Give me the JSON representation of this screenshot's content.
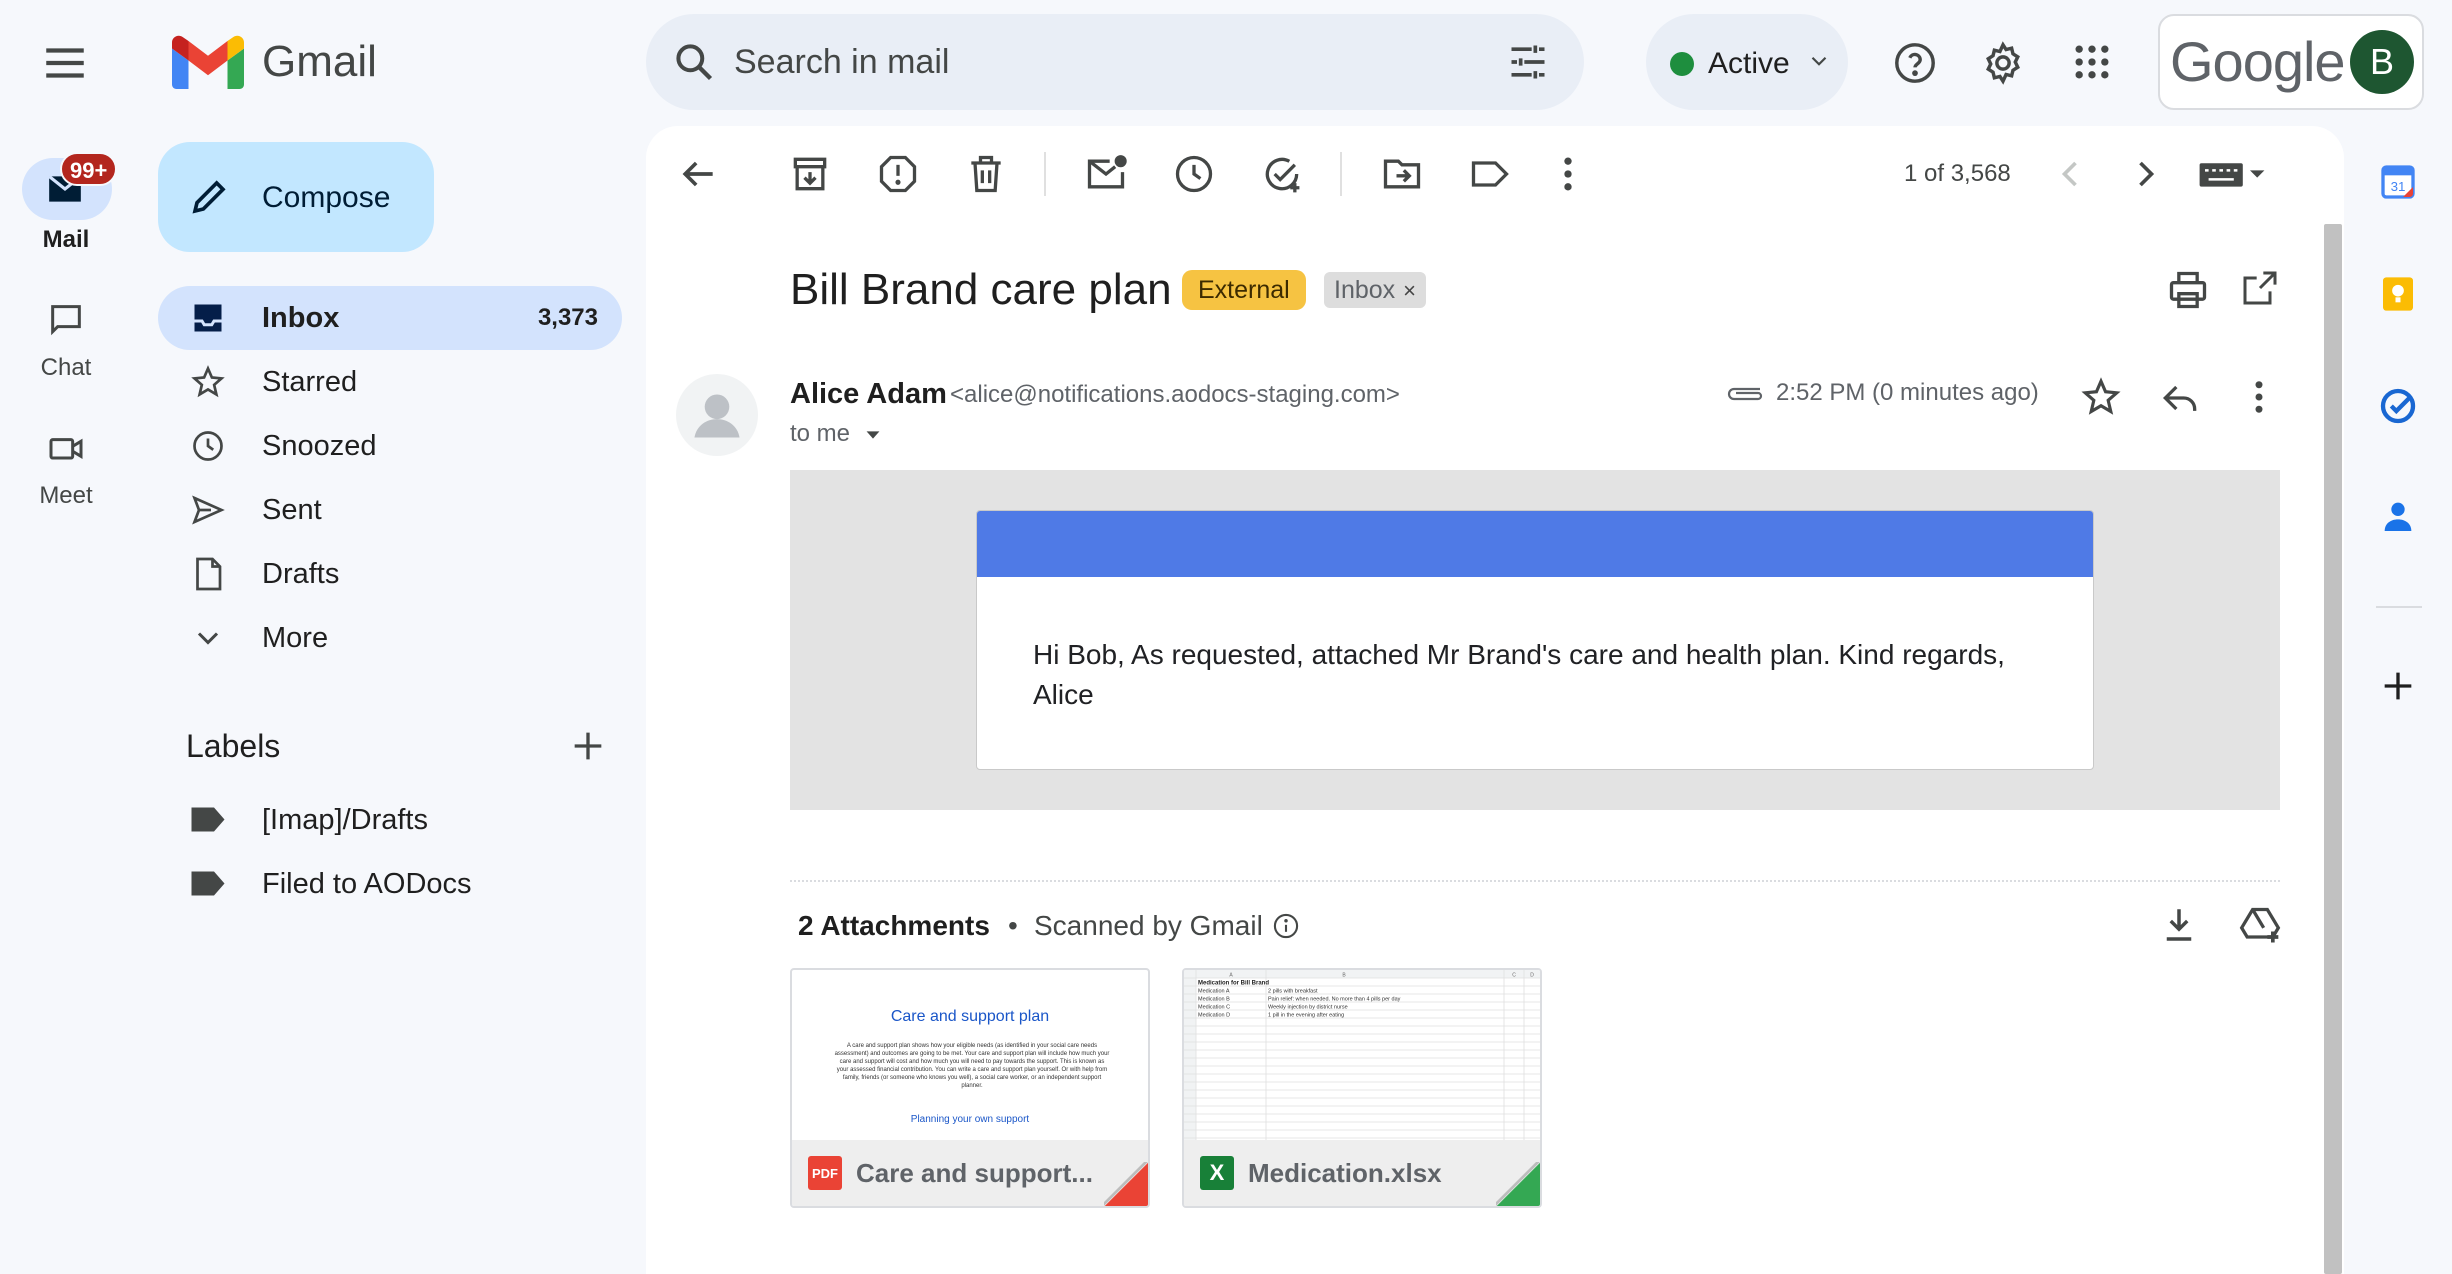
{
  "app": {
    "brand": "Gmail",
    "google_word": "Google",
    "avatar_letter": "B"
  },
  "search": {
    "placeholder": "Search in mail"
  },
  "status": {
    "label": "Active"
  },
  "rail": {
    "mail_label": "Mail",
    "mail_badge": "99+",
    "chat_label": "Chat",
    "meet_label": "Meet"
  },
  "nav": {
    "compose_label": "Compose",
    "items": [
      {
        "label": "Inbox",
        "count": "3,373"
      },
      {
        "label": "Starred",
        "count": ""
      },
      {
        "label": "Snoozed",
        "count": ""
      },
      {
        "label": "Sent",
        "count": ""
      },
      {
        "label": "Drafts",
        "count": ""
      },
      {
        "label": "More",
        "count": ""
      }
    ],
    "labels_title": "Labels",
    "labels": [
      {
        "label": "[Imap]/Drafts"
      },
      {
        "label": "Filed to AODocs"
      }
    ]
  },
  "toolbar": {
    "pager": "1 of 3,568"
  },
  "message": {
    "subject": "Bill Brand care plan",
    "tag_external": "External",
    "tag_inbox": "Inbox",
    "tag_remove": "×",
    "sender_name": "Alice Adam",
    "sender_email": "<alice@notifications.aodocs-staging.com>",
    "to": "to me",
    "time": "2:52 PM (0 minutes ago)",
    "body": "Hi Bob, As requested, attached Mr Brand's care and health plan. Kind regards, Alice"
  },
  "attachments": {
    "count_label": "2 Attachments",
    "separator": "•",
    "scanned_label": "Scanned by Gmail",
    "files": [
      {
        "name": "Care and support...",
        "type_badge": "PDF",
        "preview_title": "Care and support plan",
        "preview_text": "A care and support plan shows how your eligible needs (as identified in your social care needs assessment) and outcomes are going to be met. Your care and support plan will include how much your care and support will cost and how much you will need to pay towards the support. This is known as your assessed financial contribution. You can write a care and support plan yourself. Or with help from family, friends (or someone who knows you well), a social care worker, or an independent support planner.",
        "preview_sub": "Planning your own support"
      },
      {
        "name": "Medication.xlsx",
        "type_badge": "X",
        "preview_title": "Medication for Bill Brand",
        "preview_rows": [
          {
            "col_a": "Medication A",
            "col_b": "2 pills with breakfast"
          },
          {
            "col_a": "Medication B",
            "col_b": "Pain relief: when needed. No more than 4 pills per day"
          },
          {
            "col_a": "Medication C",
            "col_b": "Weekly injection by district nurse"
          },
          {
            "col_a": "Medication D",
            "col_b": "1 pill in the evening after eating"
          }
        ],
        "preview_cols": [
          "A",
          "B",
          "C",
          "D"
        ]
      }
    ]
  },
  "right_rail": {
    "calendar_day": "31"
  },
  "colors": {
    "accent_blue": "#c2e7ff",
    "nav_active": "#d3e3fd",
    "external_tag": "#f6c342",
    "email_header_bar": "#4f7ae6",
    "pdf_red": "#ea4335",
    "sheets_green": "#188038"
  },
  "icons": [
    "menu-icon",
    "gmail-logo",
    "search-icon",
    "filter-icon",
    "chevron-down-icon",
    "help-icon",
    "gear-icon",
    "apps-icon",
    "mail-icon",
    "chat-icon",
    "meet-icon",
    "pencil-icon",
    "inbox-icon",
    "star-icon",
    "clock-icon",
    "send-icon",
    "draft-icon",
    "chevron-icon",
    "plus-icon",
    "label-icon",
    "back-icon",
    "archive-icon",
    "report-icon",
    "trash-icon",
    "mark-unread-icon",
    "snooze-icon",
    "add-task-icon",
    "move-icon",
    "label-as-icon",
    "more-vert-icon",
    "chevron-left-icon",
    "chevron-right-icon",
    "keyboard-icon",
    "print-icon",
    "popout-icon",
    "person-icon",
    "paperclip-icon",
    "reply-icon",
    "info-icon",
    "download-icon",
    "add-to-drive-icon",
    "calendar-icon",
    "keep-icon",
    "tasks-icon",
    "contacts-icon"
  ]
}
